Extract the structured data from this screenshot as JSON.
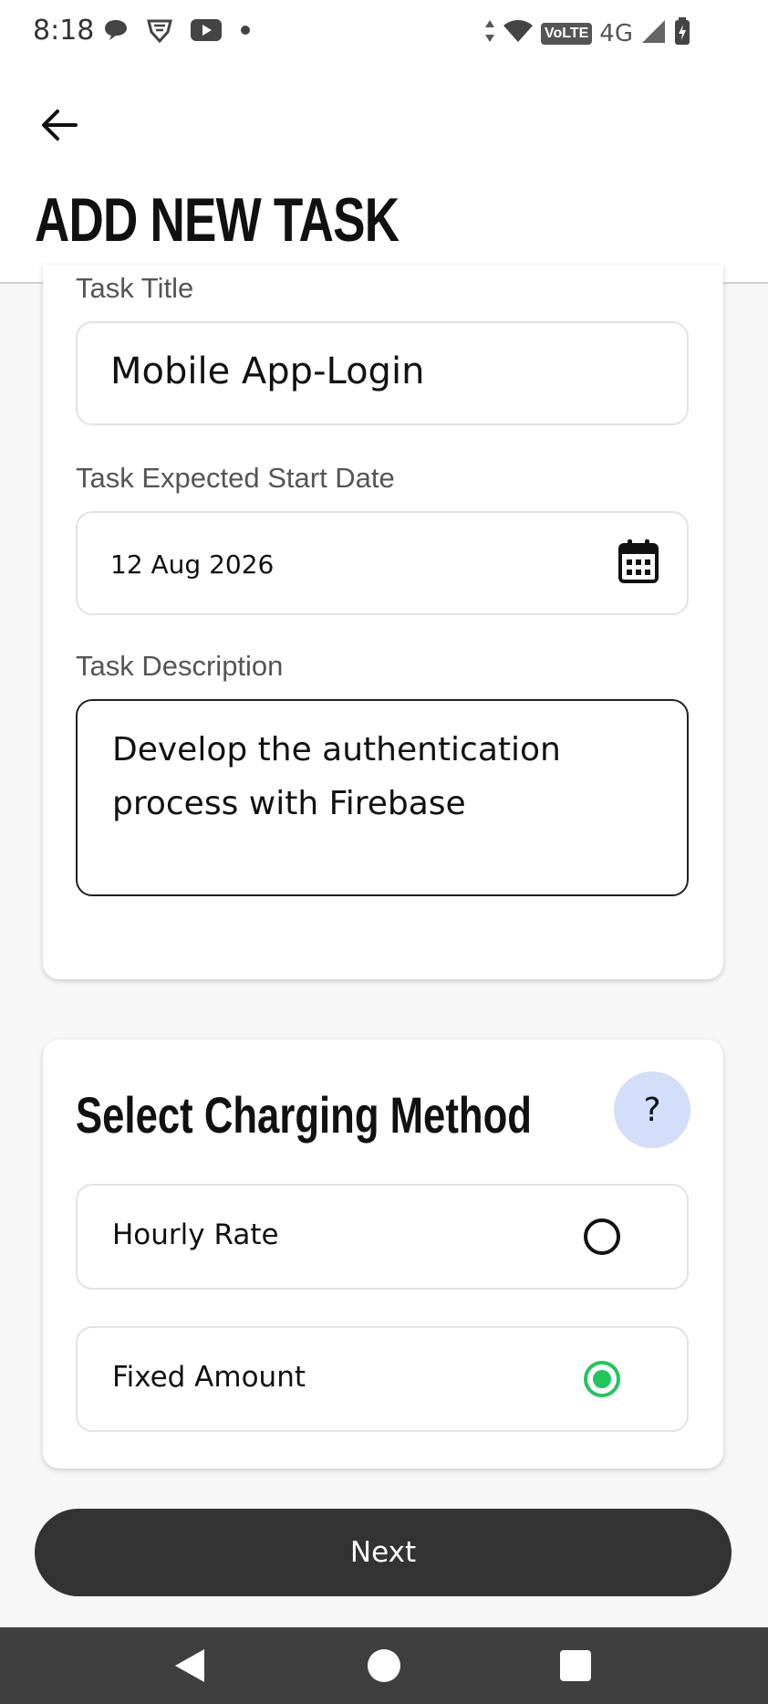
{
  "status_bar": {
    "time": "8:18",
    "network_label": "VoLTE",
    "signal_type": "4G",
    "icons": [
      "chat-bubble-icon",
      "shield-icon",
      "youtube-icon",
      "dot-icon",
      "data-arrows-icon",
      "wifi-icon",
      "signal-icon",
      "battery-charging-icon"
    ]
  },
  "header": {
    "title": "ADD NEW TASK",
    "back_icon": "arrow-left-icon"
  },
  "task_form": {
    "title_label": "Task Title",
    "title_value": "Mobile App-Login",
    "start_date_label": "Task Expected Start Date",
    "start_date_value": "12 Aug 2026",
    "calendar_icon": "calendar-icon",
    "description_label": "Task Description",
    "description_value": "Develop the authentication process with Firebase"
  },
  "charging": {
    "title": "Select Charging Method",
    "help_label": "?",
    "options": [
      {
        "label": "Hourly Rate",
        "selected": false
      },
      {
        "label": "Fixed Amount",
        "selected": true
      }
    ],
    "selected_color": "#22c55e"
  },
  "actions": {
    "next_label": "Next"
  },
  "nav": {
    "icons": [
      "back-triangle-icon",
      "home-circle-icon",
      "recents-square-icon"
    ]
  }
}
